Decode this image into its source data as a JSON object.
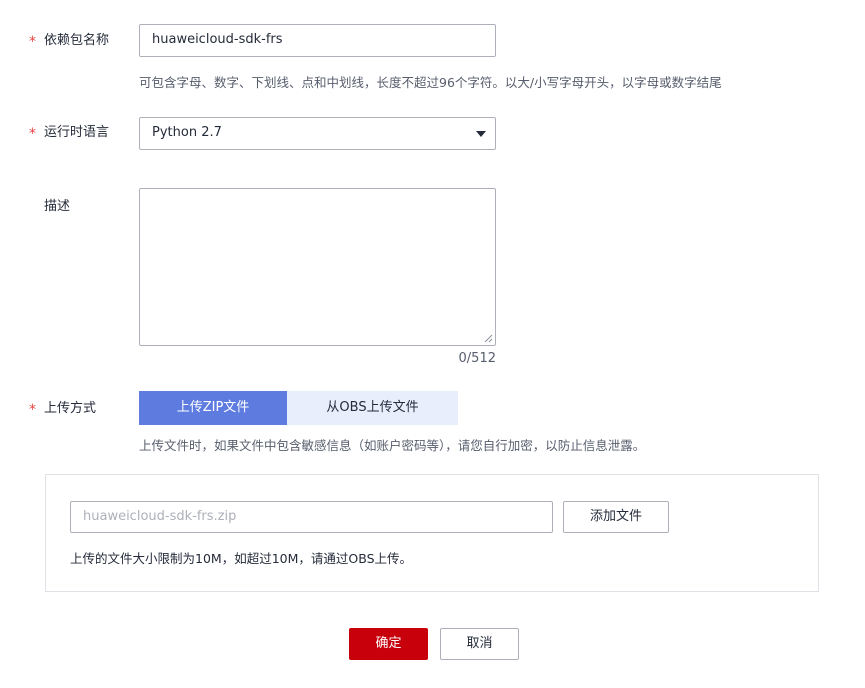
{
  "form": {
    "required_mark": "*",
    "package_name": {
      "label": "依赖包名称",
      "value": "huaweicloud-sdk-frs",
      "hint": "可包含字母、数字、下划线、点和中划线，长度不超过96个字符。以大/小写字母开头，以字母或数字结尾"
    },
    "runtime": {
      "label": "运行时语言",
      "selected": "Python 2.7"
    },
    "description": {
      "label": "描述",
      "value": "",
      "counter": "0/512"
    },
    "upload_method": {
      "label": "上传方式",
      "options": [
        "上传ZIP文件",
        "从OBS上传文件"
      ],
      "selected_index": 0,
      "hint": "上传文件时，如果文件中包含敏感信息（如账户密码等），请您自行加密，以防止信息泄露。"
    },
    "upload_panel": {
      "file_placeholder": "huaweicloud-sdk-frs.zip",
      "add_file_label": "添加文件",
      "size_limit_note": "上传的文件大小限制为10M，如超过10M，请通过OBS上传。"
    }
  },
  "actions": {
    "confirm_label": "确定",
    "cancel_label": "取消"
  },
  "colors": {
    "required": "#e54545",
    "tab_active_bg": "#5e7ce0",
    "tab_inactive_bg": "#e8eefc",
    "confirm_bg": "#c7000b",
    "border": "#adb0b8"
  },
  "icons": {
    "select_caret": "caret-down-icon",
    "textarea_resize": "resize-handle-icon"
  }
}
